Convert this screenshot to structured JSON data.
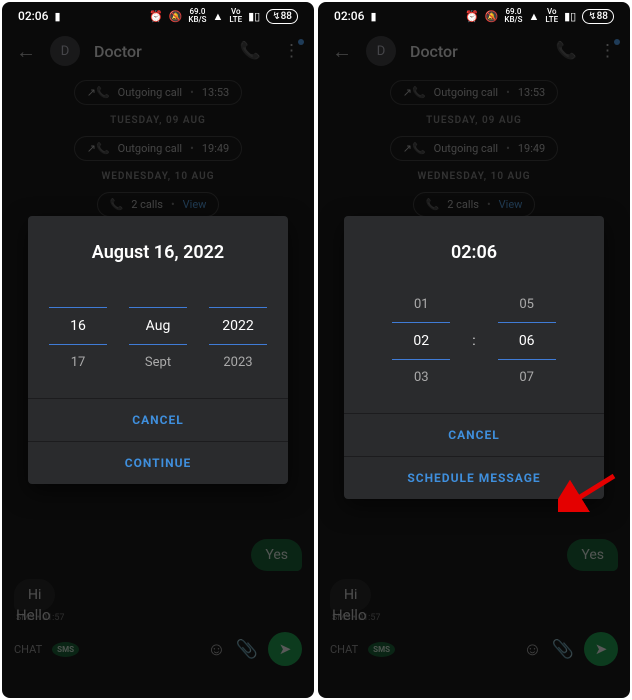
{
  "status": {
    "time": "02:06",
    "net_speed_top": "69.0",
    "net_speed_unit": "KB/S",
    "lte_top": "Vo",
    "lte_bot": "LTE",
    "battery": "88"
  },
  "header": {
    "avatar_letter": "D",
    "contact_name": "Doctor"
  },
  "chat": {
    "call1_label": "Outgoing call",
    "call1_time": "13:53",
    "sep1": "TUESDAY, 09 AUG",
    "call2_label": "Outgoing call",
    "call2_time": "19:49",
    "sep2": "WEDNESDAY, 10 AUG",
    "call3_label": "2 calls",
    "call3_view": "View",
    "bubble_out": "Yes",
    "bubble_in": "Hi",
    "meta": "SMS • 01:57"
  },
  "compose": {
    "input": "Hello",
    "chat_label": "CHAT",
    "sms_label": "SMS"
  },
  "dialog_left": {
    "title": "August 16, 2022",
    "cols": [
      {
        "prev": "",
        "cur": "16",
        "next": "17"
      },
      {
        "prev": "",
        "cur": "Aug",
        "next": "Sept"
      },
      {
        "prev": "",
        "cur": "2022",
        "next": "2023"
      }
    ],
    "btn1": "CANCEL",
    "btn2": "CONTINUE"
  },
  "dialog_right": {
    "title": "02:06",
    "cols": [
      {
        "prev": "01",
        "cur": "02",
        "next": "03"
      },
      {
        "prev": "05",
        "cur": "06",
        "next": "07"
      }
    ],
    "colon": ":",
    "btn1": "CANCEL",
    "btn2": "SCHEDULE MESSAGE"
  }
}
